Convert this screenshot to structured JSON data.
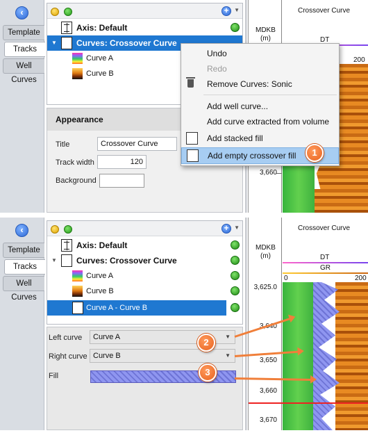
{
  "left_tabs": [
    "Template",
    "Tracks",
    "Well Curves"
  ],
  "panel1": {
    "tree": {
      "axis": "Axis: Default",
      "curves": "Curves: Crossover Curve",
      "curve_a": "Curve A",
      "curve_b": "Curve B"
    },
    "appearance": {
      "header": "Appearance",
      "title_label": "Title",
      "title_value": "Crossover Curve",
      "width_label": "Track width",
      "width_value": "120",
      "background_label": "Background"
    },
    "context_menu": {
      "undo": "Undo",
      "redo": "Redo",
      "remove": "Remove Curves: Sonic",
      "add_well_curve": "Add well curve...",
      "add_extracted": "Add curve extracted from volume",
      "add_stacked": "Add stacked fill",
      "add_crossover": "Add empty crossover fill"
    },
    "callout": "1",
    "plot": {
      "depth_header": "MDKB\n(m)",
      "track_title": "Crossover Curve",
      "curve_label": "DT",
      "scale_right": "200",
      "depth": "3,660"
    }
  },
  "panel2": {
    "tree": {
      "axis": "Axis: Default",
      "curves": "Curves: Crossover Curve",
      "curve_a": "Curve A",
      "curve_b": "Curve B",
      "fill_item": "Curve A - Curve B"
    },
    "props": {
      "left_label": "Left curve",
      "left_value": "Curve A",
      "right_label": "Right curve",
      "right_value": "Curve B",
      "fill_label": "Fill"
    },
    "callouts": [
      "2",
      "3"
    ],
    "plot": {
      "depth_header": "MDKB\n(m)",
      "track_title": "Crossover Curve",
      "curve1_label": "DT",
      "curve2_label": "GR",
      "scale_left": "0",
      "scale_right": "200",
      "depths": [
        "3,625.0",
        "3,640",
        "3,650",
        "3,660",
        "3,670"
      ]
    }
  }
}
